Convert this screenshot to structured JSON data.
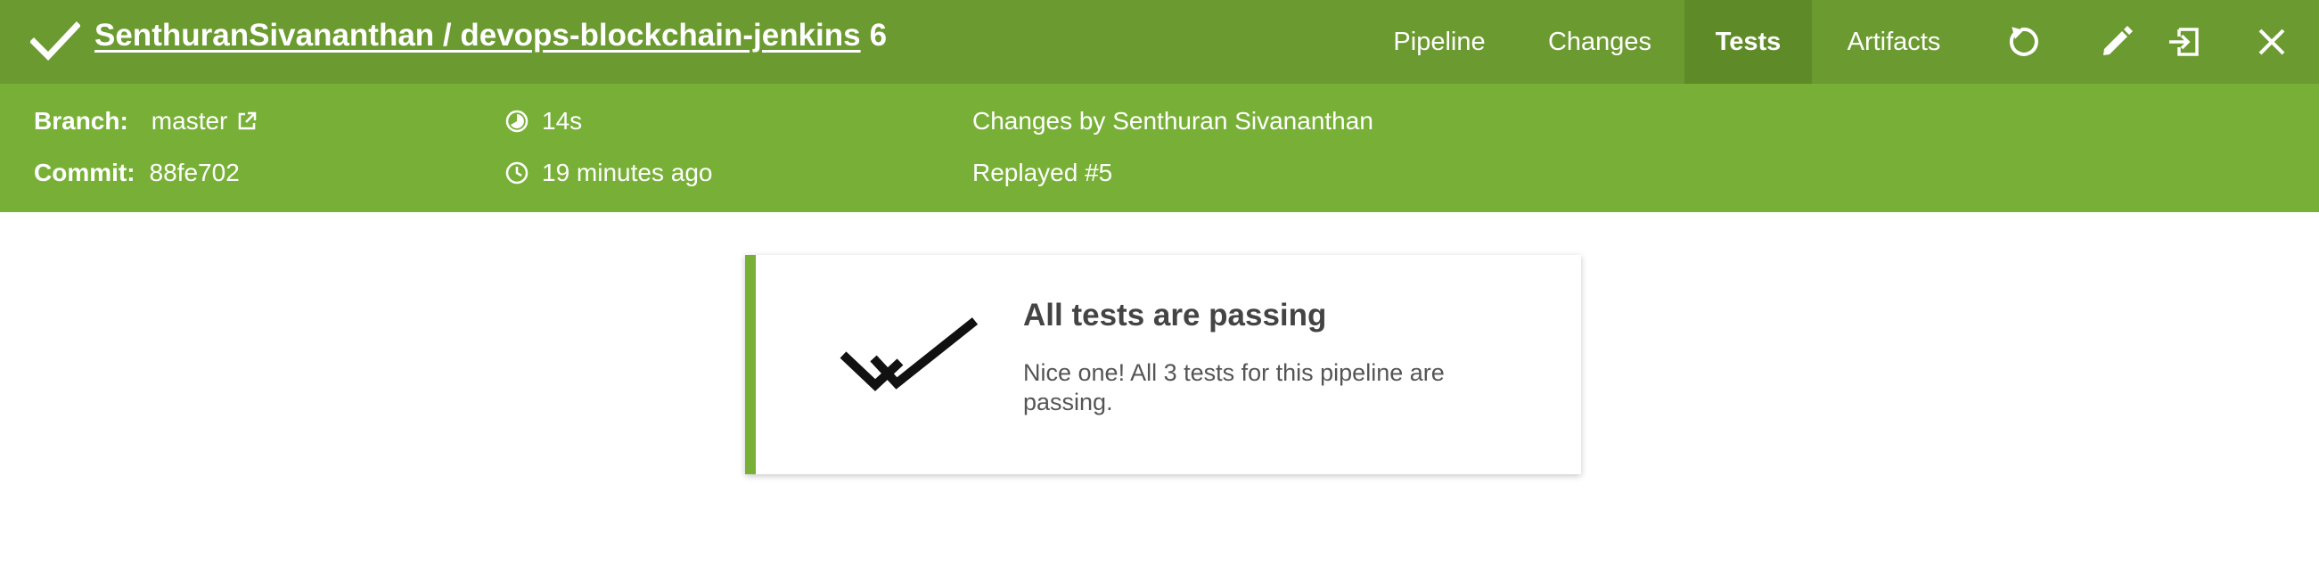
{
  "header": {
    "repo_path": "SenthuranSivananthan / devops-blockchain-jenkins",
    "run_number": "6",
    "tabs": [
      {
        "label": "Pipeline",
        "active": false
      },
      {
        "label": "Changes",
        "active": false
      },
      {
        "label": "Tests",
        "active": true
      },
      {
        "label": "Artifacts",
        "active": false
      }
    ],
    "actions": [
      "replay-icon",
      "edit-icon",
      "open-classic-icon",
      "close-icon"
    ]
  },
  "info": {
    "branch_label": "Branch:",
    "branch_value": "master",
    "commit_label": "Commit:",
    "commit_value": "88fe702",
    "duration": "14s",
    "time_ago": "19 minutes ago",
    "changes_by": "Changes by Senthuran Sivananthan",
    "replayed": "Replayed #5"
  },
  "tests": {
    "title": "All tests are passing",
    "message": "Nice one! All 3 tests for this pipeline are passing."
  },
  "colors": {
    "header_bg": "#6b9a30",
    "active_tab_bg": "#5e8b28",
    "info_bg": "#78b037",
    "accent": "#78b037"
  }
}
